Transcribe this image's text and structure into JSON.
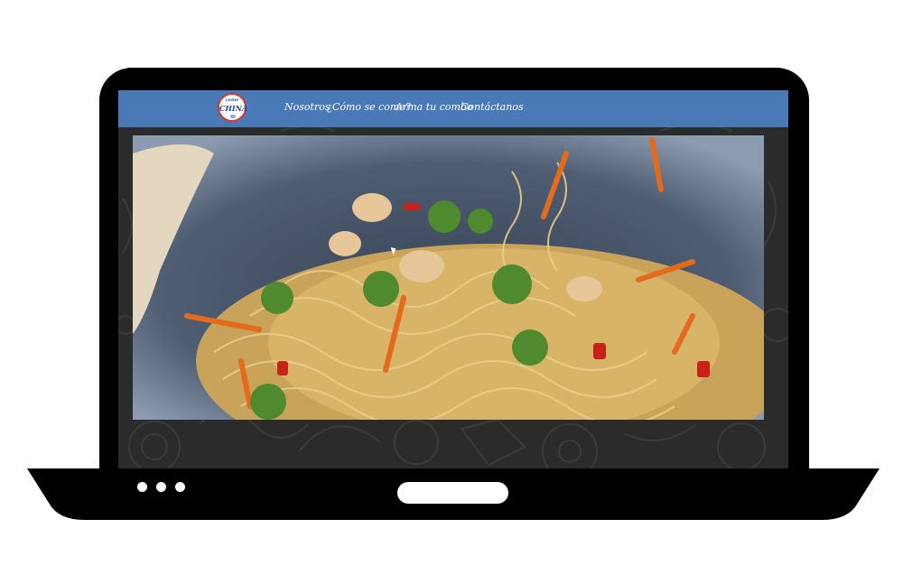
{
  "brand": {
    "logo_small_text": "come",
    "logo_main_text": "CHINA"
  },
  "nav": {
    "items": [
      {
        "label": "Nosotros"
      },
      {
        "label": "¿Cómo se come?"
      },
      {
        "label": "Arma tu combo"
      },
      {
        "label": "Contáctanos"
      }
    ]
  },
  "media": {
    "subject": "noodles-stir-fry-in-wok"
  },
  "colors": {
    "navbar": "#4a79b8",
    "laptop_frame": "#000000",
    "screen_background": "#2b2b2b",
    "logo_border": "#d63a2b"
  }
}
